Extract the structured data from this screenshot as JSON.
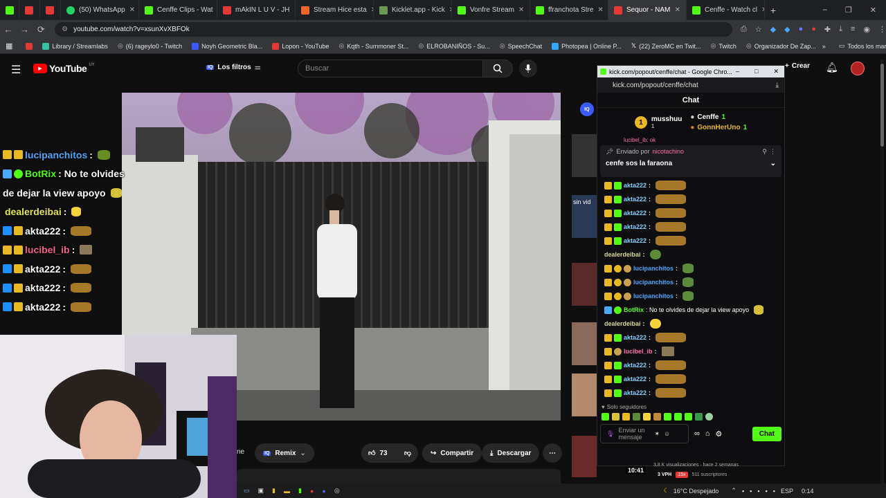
{
  "browser": {
    "tabs": [
      {
        "label": "",
        "color": "#e53935"
      },
      {
        "label": "",
        "color": "#e53935"
      },
      {
        "label": "(50) WhatsApp",
        "color": "#25d366"
      },
      {
        "label": "Cenffe Clips - Wat",
        "color": "#53fc18"
      },
      {
        "label": "mAkIN L U V - JH",
        "color": "#e53935"
      },
      {
        "label": "Stream Hice esta",
        "color": "#f06529"
      },
      {
        "label": "Kicklet.app - Kick",
        "color": "#6a9955"
      },
      {
        "label": "Vonfre Stream",
        "color": "#53fc18"
      },
      {
        "label": "ffranchota Stre",
        "color": "#53fc18"
      },
      {
        "label": "Sequor - NAM",
        "color": "#e53935"
      },
      {
        "label": "Cenffe - Watch cl",
        "color": "#53fc18"
      }
    ],
    "url": "youtube.com/watch?v=xsunXvXBFOk",
    "bookmarks": [
      "Library / Streamlabs",
      "(6) rageylo0 - Twitch",
      "Noyh Geometric Bla...",
      "Lopon - YouTube",
      "Kqth - Summoner St...",
      "ELROBANIÑOS - Su...",
      "SpeechChat",
      "Photopea | Online P...",
      "(22) ZeroMC en Twit...",
      "Twitch",
      "Organizador De Zap..."
    ],
    "bookmarks_right": "Todos los marcadores"
  },
  "youtube": {
    "logo": "YouTube",
    "region": "UY",
    "filters": "Los filtros",
    "search_placeholder": "Buscar",
    "create": "Crear",
    "likes": "73",
    "share": "Compartir",
    "download": "Descargar",
    "remix": "Remix",
    "partial_left": "ne",
    "side_text": "sin vid",
    "side_sub": "3,8 K visualizaciones · hace 2 semanas",
    "vph": "3 VPH",
    "vph_badge": "15x",
    "subs": "511 suscriptores",
    "time": "10:41"
  },
  "overlay_chat": [
    {
      "user": "lucipanchitos",
      "color": "#4aa8ff",
      "text": ":",
      "emote": true
    },
    {
      "user": "BotRix",
      "color": "#53fc18",
      "text": ": No te olvides",
      "emote": false
    },
    {
      "user": "",
      "color": "#fff",
      "text": "de dejar la view apoyo",
      "emote": false
    },
    {
      "user": "dealerdeibai",
      "color": "#e6e65a",
      "text": ":",
      "emote": false
    },
    {
      "user": "akta222",
      "color": "#fff",
      "text": ":",
      "emote": true
    },
    {
      "user": "lucibel_ib",
      "color": "#ff5c8a",
      "text": ":",
      "emote": false
    },
    {
      "user": "akta222",
      "color": "#fff",
      "text": ":",
      "emote": true
    },
    {
      "user": "akta222",
      "color": "#fff",
      "text": ":",
      "emote": true
    },
    {
      "user": "akta222",
      "color": "#fff",
      "text": ":",
      "emote": true
    }
  ],
  "popup": {
    "window_title": "kick.com/popout/cenffe/chat - Google Chro...",
    "url": "kick.com/popout/cenffe/chat",
    "heading": "Chat",
    "top_gifter": "musshuu",
    "top_gifter_count": "1",
    "leader2": "Cenffe",
    "leader2_count": "1",
    "leader3": "GonnHerUno",
    "leader3_count": "1",
    "pinned_label": "Enviado por",
    "pinned_by": "nicotachino",
    "pinned_text": "cenfe sos la faraona",
    "partial_top": "lucibel_ib: ok",
    "messages": [
      {
        "user": "akta222",
        "color": "#7fd1ff",
        "text": ":",
        "emote": true
      },
      {
        "user": "akta222",
        "color": "#7fd1ff",
        "text": ":",
        "emote": true
      },
      {
        "user": "akta222",
        "color": "#7fd1ff",
        "text": ":",
        "emote": true
      },
      {
        "user": "akta222",
        "color": "#7fd1ff",
        "text": ":",
        "emote": true
      },
      {
        "user": "akta222",
        "color": "#7fd1ff",
        "text": ":",
        "emote": true
      },
      {
        "user": "dealerdeibai",
        "color": "#d8d89a",
        "text": ":",
        "emote": false
      },
      {
        "user": "lucipanchitos",
        "color": "#4aa8ff",
        "text": ":",
        "emote": false
      },
      {
        "user": "lucipanchitos",
        "color": "#4aa8ff",
        "text": ":",
        "emote": false
      },
      {
        "user": "lucipanchitos",
        "color": "#4aa8ff",
        "text": ":",
        "emote": false
      },
      {
        "user": "BotRix",
        "color": "#53fc18",
        "text": ": No te olvides de dejar la view apoyo",
        "emote": false
      },
      {
        "user": "dealerdeibai",
        "color": "#d8d89a",
        "text": ":",
        "emote": false
      },
      {
        "user": "akta222",
        "color": "#7fd1ff",
        "text": ":",
        "emote": true
      },
      {
        "user": "lucibel_ib",
        "color": "#ff6fa8",
        "text": ":",
        "emote": false
      },
      {
        "user": "akta222",
        "color": "#7fd1ff",
        "text": ":",
        "emote": true
      },
      {
        "user": "akta222",
        "color": "#7fd1ff",
        "text": ":",
        "emote": true
      },
      {
        "user": "akta222",
        "color": "#7fd1ff",
        "text": ":",
        "emote": true
      }
    ],
    "followers_only": "Solo seguidores",
    "input_placeholder": "Enviar un mensaje",
    "chat_button": "Chat"
  },
  "taskbar": {
    "weather": "16°C Despejado",
    "lang": "ESP",
    "clock": "0:14"
  }
}
